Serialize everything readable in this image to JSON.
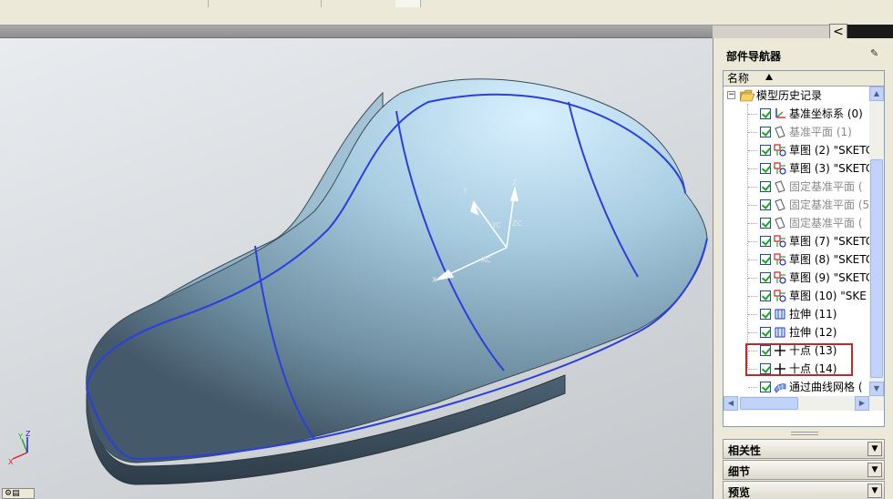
{
  "panel": {
    "title": "部件导航器",
    "column_header": "名称",
    "root_label": "模型历史记录",
    "items": [
      {
        "label": "基准坐标系 (0)",
        "icon": "csys-icon",
        "dim": false
      },
      {
        "label": "基准平面 (1)",
        "icon": "datum-plane-icon",
        "dim": true
      },
      {
        "label": "草图 (2) \"SKETC",
        "icon": "sketch-icon",
        "dim": false
      },
      {
        "label": "草图 (3) \"SKETC",
        "icon": "sketch-icon",
        "dim": false
      },
      {
        "label": "固定基准平面 (",
        "icon": "datum-plane-icon",
        "dim": true
      },
      {
        "label": "固定基准平面 (5",
        "icon": "datum-plane-icon",
        "dim": true
      },
      {
        "label": "固定基准平面 (",
        "icon": "datum-plane-icon",
        "dim": true
      },
      {
        "label": "草图 (7) \"SKETC",
        "icon": "sketch-icon",
        "dim": false
      },
      {
        "label": "草图 (8) \"SKETC",
        "icon": "sketch-icon",
        "dim": false
      },
      {
        "label": "草图 (9) \"SKETC",
        "icon": "sketch-icon",
        "dim": false
      },
      {
        "label": "草图 (10) \"SKE",
        "icon": "sketch-icon",
        "dim": false
      },
      {
        "label": "拉伸 (11)",
        "icon": "extrude-icon",
        "dim": false
      },
      {
        "label": "拉伸 (12)",
        "icon": "extrude-icon",
        "dim": false
      },
      {
        "label": "十点 (13)",
        "icon": "point-icon",
        "dim": false
      },
      {
        "label": "十点 (14)",
        "icon": "point-icon",
        "dim": false
      },
      {
        "label": "通过曲线网格 (",
        "icon": "mesh-surface-icon",
        "dim": false
      }
    ],
    "sections": [
      "相关性",
      "细节",
      "预览"
    ]
  },
  "viewport": {
    "csys_labels": {
      "x": "X",
      "y": "Y",
      "z": "Z",
      "xc": "XC",
      "yc": "YC",
      "zc": "ZC"
    },
    "triad_labels": {
      "x": "X",
      "y": "Y",
      "z": "Z"
    }
  },
  "toolbar": {
    "collapse_glyph": "<"
  },
  "colors": {
    "surface": "#8fb4c9",
    "curves": "#2a3fe0",
    "highlight": "#c0282a"
  }
}
